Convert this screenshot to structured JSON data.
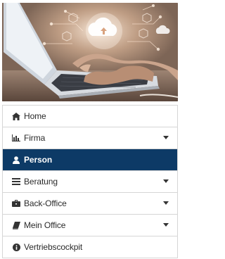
{
  "menu": {
    "items": [
      {
        "label": "Home"
      },
      {
        "label": "Firma"
      },
      {
        "label": "Person"
      },
      {
        "label": "Beratung"
      },
      {
        "label": "Back-Office"
      },
      {
        "label": "Mein Office"
      },
      {
        "label": "Vertriebscockpit"
      }
    ],
    "active_color": "#0d3a66"
  }
}
